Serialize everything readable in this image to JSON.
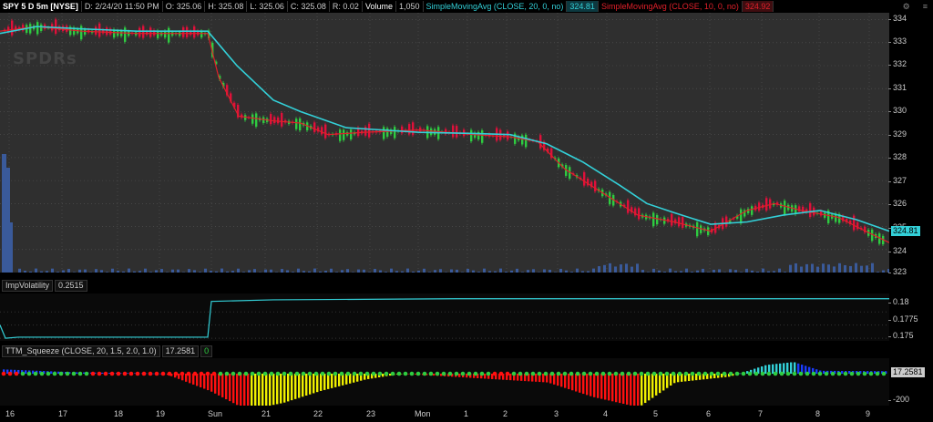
{
  "header": {
    "symbol": "SPY 5 D 5m [NYSE]",
    "date": "D: 2/24/20 11:50 PM",
    "open": "O: 325.06",
    "high": "H: 325.08",
    "low": "L: 325.06",
    "close": "C: 325.08",
    "range": "R: 0.02",
    "volume_label": "Volume",
    "volume_value": "1,050",
    "sma20_label": "SimpleMovingAvg (CLOSE, 20, 0, no)",
    "sma20_value": "324.81",
    "sma10_label": "SimpleMovingAvg (CLOSE, 10, 0, no)",
    "sma10_value": "324.92"
  },
  "logo_text": "SPDRs",
  "price_axis": {
    "ticks": [
      "334",
      "333",
      "332",
      "331",
      "330",
      "329",
      "328",
      "327",
      "326",
      "325",
      "324",
      "323"
    ],
    "last_tag": "324.81"
  },
  "iv_study": {
    "label": "ImpVolatility",
    "value": "0.2515",
    "ticks": [
      "0.18",
      "0.1775",
      "0.175"
    ]
  },
  "squeeze_study": {
    "label": "TTM_Squeeze (CLOSE, 20, 1.5, 2.0, 1.0)",
    "value": "17.2581",
    "zero": "0",
    "tag": "17.2581",
    "ticks": [
      "-200"
    ]
  },
  "time_axis": [
    "16",
    "17",
    "18",
    "19",
    "Sun",
    "21",
    "22",
    "23",
    "Mon",
    "1",
    "2",
    "3",
    "4",
    "5",
    "6",
    "7",
    "8",
    "9"
  ],
  "colors": {
    "sma20": "#33d0d8",
    "sma10": "#e0202a",
    "up_candle": "#2ecc40",
    "down_candle": "#e0103a",
    "volume": "#3a5a9a",
    "grid": "#555555"
  },
  "chart_data": {
    "type": "line",
    "price_range": [
      323,
      334.3
    ],
    "sma20": [
      [
        0,
        333.4
      ],
      [
        40,
        333.7
      ],
      [
        90,
        333.6
      ],
      [
        150,
        333.5
      ],
      [
        228,
        333.5
      ],
      [
        260,
        332
      ],
      [
        300,
        330.5
      ],
      [
        330,
        330
      ],
      [
        380,
        329.3
      ],
      [
        420,
        329.2
      ],
      [
        460,
        329.1
      ],
      [
        520,
        329.05
      ],
      [
        560,
        329
      ],
      [
        600,
        328.6
      ],
      [
        640,
        327.8
      ],
      [
        680,
        326.8
      ],
      [
        710,
        326
      ],
      [
        740,
        325.6
      ],
      [
        780,
        325.1
      ],
      [
        820,
        325.2
      ],
      [
        860,
        325.5
      ],
      [
        900,
        325.7
      ],
      [
        940,
        325.3
      ],
      [
        976,
        324.8
      ]
    ],
    "sma10": [
      [
        0,
        333.5
      ],
      [
        40,
        333.7
      ],
      [
        90,
        333.5
      ],
      [
        150,
        333.4
      ],
      [
        228,
        333.4
      ],
      [
        240,
        331.5
      ],
      [
        262,
        329.8
      ],
      [
        300,
        329.6
      ],
      [
        330,
        329.5
      ],
      [
        360,
        329
      ],
      [
        400,
        329.1
      ],
      [
        460,
        329.2
      ],
      [
        520,
        329
      ],
      [
        560,
        328.9
      ],
      [
        590,
        328.7
      ],
      [
        620,
        327.5
      ],
      [
        660,
        326.5
      ],
      [
        700,
        325.5
      ],
      [
        740,
        325.2
      ],
      [
        780,
        324.8
      ],
      [
        820,
        325.7
      ],
      [
        850,
        326
      ],
      [
        880,
        325.7
      ],
      [
        920,
        325.4
      ],
      [
        950,
        324.8
      ],
      [
        976,
        324.3
      ]
    ],
    "implied_volatility": [
      [
        0,
        0.1775
      ],
      [
        6,
        0.175
      ],
      [
        20,
        0.1752
      ],
      [
        228,
        0.1752
      ],
      [
        232,
        0.182
      ],
      [
        300,
        0.1823
      ],
      [
        500,
        0.1825
      ],
      [
        700,
        0.1825
      ],
      [
        976,
        0.1825
      ]
    ],
    "squeeze_momentum": [
      [
        0,
        30
      ],
      [
        80,
        10
      ],
      [
        180,
        0
      ],
      [
        230,
        -120
      ],
      [
        270,
        -250
      ],
      [
        310,
        -200
      ],
      [
        350,
        -120
      ],
      [
        400,
        -40
      ],
      [
        440,
        0
      ],
      [
        600,
        -60
      ],
      [
        650,
        -160
      ],
      [
        700,
        -230
      ],
      [
        740,
        -60
      ],
      [
        800,
        -20
      ],
      [
        840,
        60
      ],
      [
        870,
        80
      ],
      [
        900,
        20
      ],
      [
        976,
        17
      ]
    ]
  }
}
